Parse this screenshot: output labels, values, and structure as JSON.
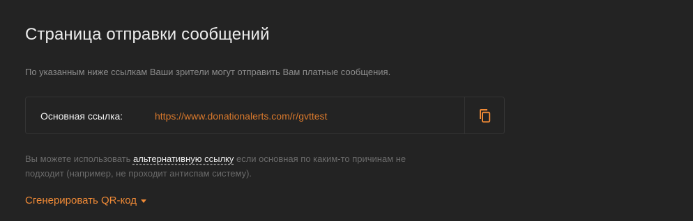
{
  "page": {
    "title": "Страница отправки сообщений",
    "subtitle": "По указанным ниже ссылкам Ваши зрители могут отправить Вам платные сообщения."
  },
  "main_link": {
    "label": "Основная ссылка:",
    "url": "https://www.donationalerts.com/r/gvttest",
    "copy_icon": "copy-icon"
  },
  "note": {
    "before": "Вы можете использовать ",
    "link_text": "альтернативную ссылку",
    "after": " если основная по каким-то причинам не подходит (например, не проходит антиспам систему)."
  },
  "qr": {
    "label": "Сгенерировать QR-код",
    "icon": "caret-down-icon"
  },
  "colors": {
    "background": "#232323",
    "accent": "#f08a36",
    "link": "#d9792c"
  }
}
